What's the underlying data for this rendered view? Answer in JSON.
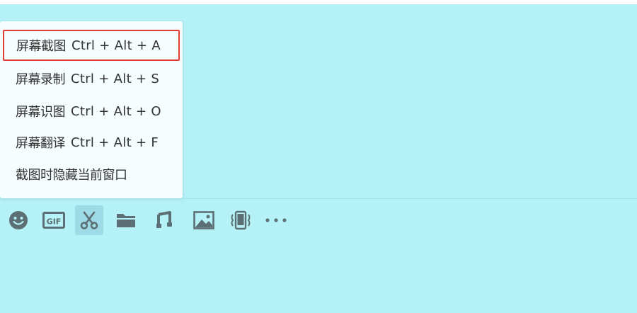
{
  "screenshot_menu": {
    "items": [
      {
        "label": "屏幕截图",
        "shortcut": "Ctrl + Alt + A",
        "highlighted": true
      },
      {
        "label": "屏幕录制",
        "shortcut": "Ctrl + Alt + S",
        "highlighted": false
      },
      {
        "label": "屏幕识图",
        "shortcut": "Ctrl + Alt + O",
        "highlighted": false
      },
      {
        "label": "屏幕翻译",
        "shortcut": "Ctrl + Alt + F",
        "highlighted": false
      },
      {
        "label": "截图时隐藏当前窗口",
        "shortcut": "",
        "highlighted": false
      }
    ]
  },
  "toolbar": {
    "buttons": [
      {
        "icon": "emoji-icon"
      },
      {
        "icon": "gif-icon",
        "text": "GIF"
      },
      {
        "icon": "scissors-icon",
        "active": true
      },
      {
        "icon": "folder-icon"
      },
      {
        "icon": "music-icon"
      },
      {
        "icon": "image-icon"
      },
      {
        "icon": "shake-window-icon"
      },
      {
        "icon": "more-icon"
      }
    ]
  },
  "colors": {
    "background": "#b5f2f7",
    "menu_background": "#f6fdfe",
    "highlight_border": "#e03b36",
    "icon": "#5c6f74",
    "active_button": "#9ddbe6"
  }
}
